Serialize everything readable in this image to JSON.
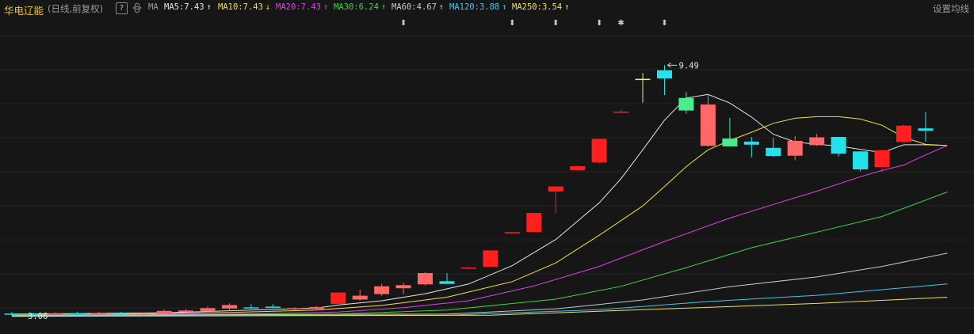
{
  "header": {
    "stock_name": "华电辽能",
    "period_label": "(日线,前复权)",
    "help_label": "?",
    "ma_label": "MA",
    "settings_label": "设置均线",
    "indicators": [
      {
        "name": "MA5",
        "value": "7.43",
        "arrow": "↑",
        "color": "#e6e6e6"
      },
      {
        "name": "MA10",
        "value": "7.43",
        "arrow": "↓",
        "color": "#f0e040"
      },
      {
        "name": "MA20",
        "value": "7.43",
        "arrow": "↑",
        "color": "#e040e8"
      },
      {
        "name": "MA30",
        "value": "6.24",
        "arrow": "↑",
        "color": "#39d53f"
      },
      {
        "name": "MA60",
        "value": "4.67",
        "arrow": "↑",
        "color": "#c8c8c8"
      },
      {
        "name": "MA120",
        "value": "3.88",
        "arrow": "↑",
        "color": "#3cc8ee"
      },
      {
        "name": "MA250",
        "value": "3.54",
        "arrow": "↑",
        "color": "#f0e060"
      }
    ]
  },
  "chart_data": {
    "type": "candlestick",
    "colors": {
      "up": "#ff1f1f",
      "up_light": "#ff6868",
      "down": "#22e3ec",
      "down_light": "#47ee8e",
      "doji": "#f5e49a"
    },
    "high_label": "9.49",
    "low_label": "3.06",
    "candles": [
      {
        "open": 3.12,
        "high": 3.16,
        "low": 3.06,
        "close": 3.1,
        "color": "down"
      },
      {
        "open": 3.1,
        "high": 3.14,
        "low": 3.06,
        "close": 3.12,
        "color": "down"
      },
      {
        "open": 3.11,
        "high": 3.15,
        "low": 3.07,
        "close": 3.13,
        "color": "up_light"
      },
      {
        "open": 3.12,
        "high": 3.17,
        "low": 3.09,
        "close": 3.13,
        "color": "down"
      },
      {
        "open": 3.13,
        "high": 3.16,
        "low": 3.09,
        "close": 3.11,
        "color": "up_light"
      },
      {
        "open": 3.12,
        "high": 3.16,
        "low": 3.08,
        "close": 3.11,
        "color": "down"
      },
      {
        "open": 3.11,
        "high": 3.15,
        "low": 3.07,
        "close": 3.12,
        "color": "up_light"
      },
      {
        "open": 3.12,
        "high": 3.22,
        "low": 3.1,
        "close": 3.19,
        "color": "up_light"
      },
      {
        "open": 3.16,
        "high": 3.24,
        "low": 3.14,
        "close": 3.2,
        "color": "up_light"
      },
      {
        "open": 3.18,
        "high": 3.3,
        "low": 3.16,
        "close": 3.26,
        "color": "up_light"
      },
      {
        "open": 3.25,
        "high": 3.38,
        "low": 3.22,
        "close": 3.34,
        "color": "up_light"
      },
      {
        "open": 3.28,
        "high": 3.36,
        "low": 3.24,
        "close": 3.27,
        "color": "down"
      },
      {
        "open": 3.3,
        "high": 3.36,
        "low": 3.26,
        "close": 3.27,
        "color": "down"
      },
      {
        "open": 3.23,
        "high": 3.28,
        "low": 3.2,
        "close": 3.26,
        "color": "up_light"
      },
      {
        "open": 3.24,
        "high": 3.31,
        "low": 3.22,
        "close": 3.29,
        "color": "up_light"
      },
      {
        "open": 3.37,
        "high": 3.67,
        "low": 3.36,
        "close": 3.66,
        "color": "up"
      },
      {
        "open": 3.48,
        "high": 3.73,
        "low": 3.45,
        "close": 3.58,
        "color": "up_light"
      },
      {
        "open": 3.62,
        "high": 3.88,
        "low": 3.58,
        "close": 3.82,
        "color": "up_light"
      },
      {
        "open": 3.77,
        "high": 3.91,
        "low": 3.62,
        "close": 3.85,
        "color": "up_light"
      },
      {
        "open": 3.87,
        "high": 4.18,
        "low": 3.84,
        "close": 4.16,
        "color": "up_light"
      },
      {
        "open": 3.95,
        "high": 4.16,
        "low": 3.89,
        "close": 3.88,
        "color": "down"
      },
      {
        "open": 4.29,
        "high": 4.32,
        "low": 4.27,
        "close": 4.3,
        "color": "up"
      },
      {
        "open": 4.32,
        "high": 4.74,
        "low": 4.32,
        "close": 4.74,
        "color": "up"
      },
      {
        "open": 5.21,
        "high": 5.22,
        "low": 5.19,
        "close": 5.21,
        "color": "up"
      },
      {
        "open": 5.21,
        "high": 5.7,
        "low": 5.2,
        "close": 5.7,
        "color": "up"
      },
      {
        "open": 6.25,
        "high": 6.3,
        "low": 5.7,
        "close": 6.38,
        "color": "up"
      },
      {
        "open": 6.8,
        "high": 6.92,
        "low": 6.78,
        "close": 6.9,
        "color": "up"
      },
      {
        "open": 7.0,
        "high": 7.6,
        "low": 6.96,
        "close": 7.6,
        "color": "up"
      },
      {
        "open": 8.3,
        "high": 8.35,
        "low": 8.29,
        "close": 8.3,
        "color": "up"
      },
      {
        "open": 9.14,
        "high": 9.29,
        "low": 8.53,
        "close": 9.14,
        "color": "doji"
      },
      {
        "open": 9.36,
        "high": 9.49,
        "low": 8.72,
        "close": 9.15,
        "color": "down"
      },
      {
        "open": 8.65,
        "high": 8.8,
        "low": 8.25,
        "close": 8.33,
        "color": "down_light"
      },
      {
        "open": 7.42,
        "high": 8.74,
        "low": 7.4,
        "close": 8.48,
        "color": "up_light"
      },
      {
        "open": 7.61,
        "high": 8.14,
        "low": 7.4,
        "close": 7.41,
        "color": "down_light"
      },
      {
        "open": 7.53,
        "high": 7.65,
        "low": 7.13,
        "close": 7.45,
        "color": "down"
      },
      {
        "open": 7.37,
        "high": 7.63,
        "low": 7.14,
        "close": 7.16,
        "color": "down"
      },
      {
        "open": 7.17,
        "high": 7.67,
        "low": 7.05,
        "close": 7.55,
        "color": "up_light"
      },
      {
        "open": 7.44,
        "high": 7.73,
        "low": 7.42,
        "close": 7.64,
        "color": "up_light"
      },
      {
        "open": 7.65,
        "high": 7.65,
        "low": 7.15,
        "close": 7.22,
        "color": "down"
      },
      {
        "open": 7.28,
        "high": 7.28,
        "low": 6.77,
        "close": 6.82,
        "color": "down"
      },
      {
        "open": 6.88,
        "high": 7.32,
        "low": 6.74,
        "close": 7.31,
        "color": "up"
      },
      {
        "open": 7.52,
        "high": 7.97,
        "low": 7.5,
        "close": 7.94,
        "color": "up"
      },
      {
        "open": 7.81,
        "high": 8.29,
        "low": 7.53,
        "close": 7.87,
        "color": "down"
      }
    ],
    "ma_series": [
      {
        "name": "MA5",
        "color": "#e6e6e6",
        "points": [
          [
            0,
            3.11
          ],
          [
            3,
            3.12
          ],
          [
            7,
            3.14
          ],
          [
            11,
            3.21
          ],
          [
            14,
            3.26
          ],
          [
            15,
            3.34
          ],
          [
            17,
            3.45
          ],
          [
            19,
            3.63
          ],
          [
            21,
            3.88
          ],
          [
            23,
            4.35
          ],
          [
            25,
            5.02
          ],
          [
            27,
            5.96
          ],
          [
            28,
            6.58
          ],
          [
            29,
            7.32
          ],
          [
            30,
            8.08
          ],
          [
            31,
            8.65
          ],
          [
            32,
            8.74
          ],
          [
            33,
            8.52
          ],
          [
            34,
            8.16
          ],
          [
            35,
            7.72
          ],
          [
            36,
            7.52
          ],
          [
            37,
            7.46
          ],
          [
            38,
            7.42
          ],
          [
            39,
            7.33
          ],
          [
            40,
            7.25
          ],
          [
            41,
            7.45
          ],
          [
            42,
            7.45
          ],
          [
            43,
            7.43
          ]
        ]
      },
      {
        "name": "MA10",
        "color": "#f0e040",
        "points": [
          [
            0,
            3.1
          ],
          [
            5,
            3.11
          ],
          [
            10,
            3.15
          ],
          [
            14,
            3.21
          ],
          [
            17,
            3.33
          ],
          [
            20,
            3.54
          ],
          [
            23,
            3.94
          ],
          [
            25,
            4.42
          ],
          [
            27,
            5.13
          ],
          [
            29,
            5.88
          ],
          [
            30,
            6.38
          ],
          [
            31,
            6.89
          ],
          [
            32,
            7.32
          ],
          [
            33,
            7.56
          ],
          [
            34,
            7.77
          ],
          [
            35,
            8.0
          ],
          [
            36,
            8.13
          ],
          [
            37,
            8.17
          ],
          [
            38,
            8.17
          ],
          [
            39,
            8.11
          ],
          [
            40,
            7.95
          ],
          [
            41,
            7.64
          ],
          [
            42,
            7.46
          ],
          [
            43,
            7.43
          ]
        ]
      },
      {
        "name": "MA20",
        "color": "#e040e8",
        "points": [
          [
            0,
            3.09
          ],
          [
            10,
            3.11
          ],
          [
            15,
            3.16
          ],
          [
            18,
            3.27
          ],
          [
            21,
            3.45
          ],
          [
            24,
            3.83
          ],
          [
            27,
            4.33
          ],
          [
            30,
            4.97
          ],
          [
            33,
            5.57
          ],
          [
            35,
            5.92
          ],
          [
            37,
            6.26
          ],
          [
            39,
            6.63
          ],
          [
            40,
            6.79
          ],
          [
            41,
            6.93
          ],
          [
            42,
            7.19
          ],
          [
            43,
            7.43
          ]
        ]
      },
      {
        "name": "MA30",
        "color": "#39d53f",
        "points": [
          [
            0,
            3.08
          ],
          [
            15,
            3.11
          ],
          [
            20,
            3.21
          ],
          [
            25,
            3.49
          ],
          [
            28,
            3.82
          ],
          [
            31,
            4.3
          ],
          [
            34,
            4.81
          ],
          [
            37,
            5.21
          ],
          [
            40,
            5.61
          ],
          [
            43,
            6.24
          ]
        ]
      },
      {
        "name": "MA60",
        "color": "#c8c8c8",
        "points": [
          [
            0,
            3.07
          ],
          [
            20,
            3.11
          ],
          [
            25,
            3.24
          ],
          [
            29,
            3.47
          ],
          [
            33,
            3.81
          ],
          [
            37,
            4.06
          ],
          [
            40,
            4.33
          ],
          [
            43,
            4.67
          ]
        ]
      },
      {
        "name": "MA120",
        "color": "#3cc8ee",
        "points": [
          [
            0,
            3.06
          ],
          [
            20,
            3.08
          ],
          [
            27,
            3.22
          ],
          [
            32,
            3.43
          ],
          [
            37,
            3.59
          ],
          [
            43,
            3.88
          ]
        ]
      },
      {
        "name": "MA250",
        "color": "#f0e060",
        "points": [
          [
            0,
            3.05
          ],
          [
            22,
            3.08
          ],
          [
            30,
            3.24
          ],
          [
            37,
            3.38
          ],
          [
            43,
            3.54
          ]
        ]
      }
    ],
    "event_markers": [
      {
        "index": 18,
        "symbol": "⬍"
      },
      {
        "index": 23,
        "symbol": "⬍"
      },
      {
        "index": 25,
        "symbol": "⬍"
      },
      {
        "index": 27,
        "symbol": "⬍"
      },
      {
        "index": 28,
        "symbol": "✱"
      },
      {
        "index": 30,
        "symbol": "⬍"
      }
    ],
    "ylim": [
      2.8,
      10.35
    ],
    "grid": true
  }
}
